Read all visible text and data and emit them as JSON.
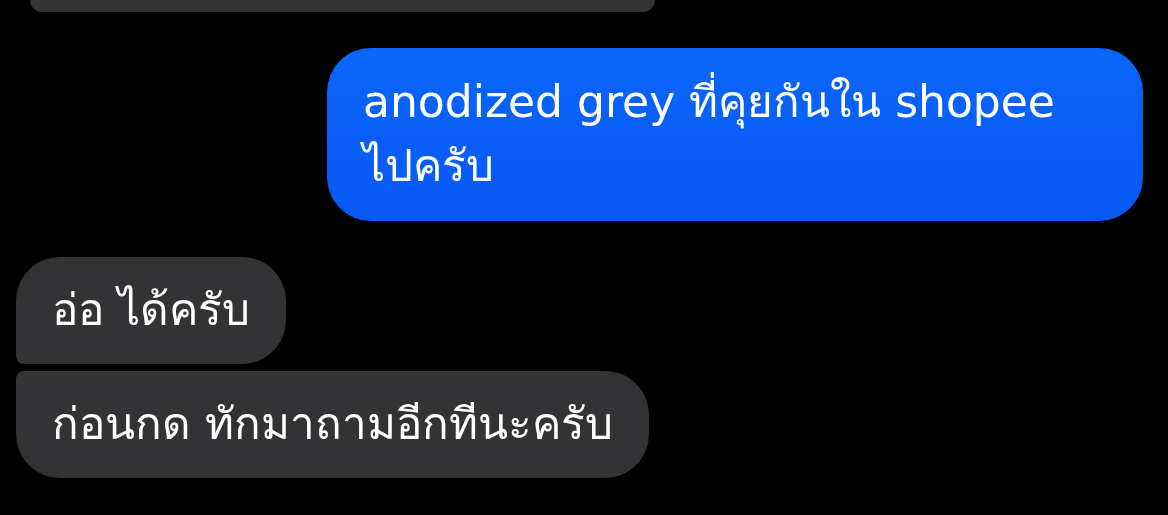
{
  "messages": [
    {
      "kind": "received",
      "cut_off": true
    },
    {
      "kind": "sent",
      "text": "anodized grey ที่คุยกันใน shopee ไปครับ"
    },
    {
      "kind": "received",
      "text": "อ่อ ได้ครับ"
    },
    {
      "kind": "received",
      "text": "ก่อนกด ทักมาถามอีกทีนะครับ"
    }
  ]
}
